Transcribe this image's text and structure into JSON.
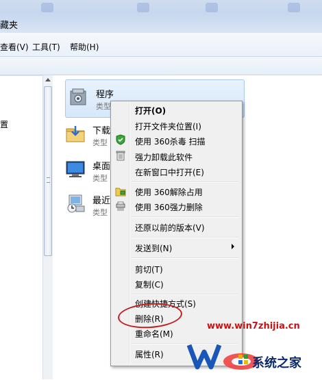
{
  "window": {
    "title": "藏夹"
  },
  "menubar": {
    "items": [
      "查看(V)",
      "工具(T)",
      "帮助(H)"
    ]
  },
  "navpane": {
    "items": [
      "置"
    ]
  },
  "content": {
    "items": [
      {
        "name": "程序",
        "type": "类型",
        "icon": "programs-folder-icon"
      },
      {
        "name": "下载",
        "type": "类型",
        "icon": "downloads-folder-icon"
      },
      {
        "name": "桌面",
        "type": "类型",
        "icon": "desktop-icon"
      },
      {
        "name": "最近",
        "type": "类型",
        "icon": "recent-places-icon"
      }
    ]
  },
  "context_menu": {
    "items": [
      {
        "label": "打开(O)",
        "bold": true
      },
      {
        "label": "打开文件夹位置(I)"
      },
      {
        "label": "使用 360杀毒 扫描",
        "icon": "360-shield-icon"
      },
      {
        "label": "强力卸载此软件",
        "icon": "trash-icon"
      },
      {
        "label": "在新窗口中打开(E)"
      },
      {
        "label": "使用 360解除占用",
        "icon": "unlock-folder-icon"
      },
      {
        "label": "使用 360强力删除",
        "icon": "shredder-icon"
      },
      {
        "label": "还原以前的版本(V)"
      },
      {
        "label": "发送到(N)",
        "submenu": true
      },
      {
        "label": "剪切(T)"
      },
      {
        "label": "复制(C)"
      },
      {
        "label": "创建快捷方式(S)"
      },
      {
        "label": "删除(R)",
        "highlighted": true
      },
      {
        "label": "重命名(M)"
      },
      {
        "label": "属性(R)"
      }
    ]
  },
  "watermark": {
    "url": "www.win7zhijia.cn",
    "brand": "系统之家"
  },
  "colors": {
    "highlight": "#c02020",
    "watermark_url": "#cc1010"
  }
}
